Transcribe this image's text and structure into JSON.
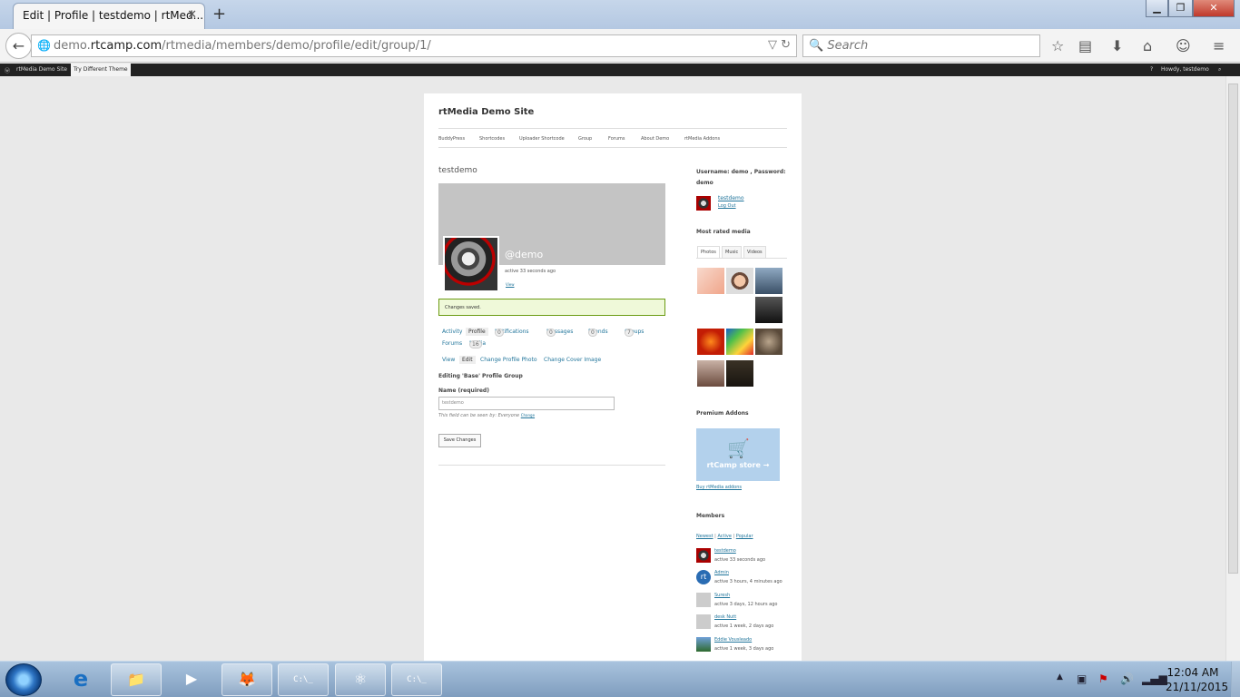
{
  "browser": {
    "tab_title": "Edit | Profile | testdemo | rtMed...",
    "url_prefix": "demo.",
    "url_domain": "rtcamp.com",
    "url_path": "/rtmedia/members/demo/profile/edit/group/1/",
    "search_placeholder": "Search"
  },
  "adminbar": {
    "site_link": "rtMedia Demo Site",
    "try_theme": "Try Different Theme",
    "howdy": "Howdy, testdemo"
  },
  "site": {
    "title": "rtMedia Demo Site",
    "nav": [
      "BuddyPress",
      "Shortcodes",
      "Uploader Shortcode",
      "Group",
      "Forums",
      "About Demo",
      "rtMedia Addons"
    ]
  },
  "profile": {
    "name": "testdemo",
    "handle": "@demo",
    "activity": "active 33 seconds ago",
    "view_link": "View",
    "notice": "Changes saved.",
    "tabs": [
      {
        "label": "Activity"
      },
      {
        "label": "Profile"
      },
      {
        "label": "Notifications",
        "count": "0"
      },
      {
        "label": "Messages",
        "count": "0"
      },
      {
        "label": "Friends",
        "count": "0"
      },
      {
        "label": "Groups",
        "count": "7"
      },
      {
        "label": "Forums"
      },
      {
        "label": "Media",
        "count": "16"
      }
    ],
    "subtabs": [
      "View",
      "Edit",
      "Change Profile Photo",
      "Change Cover Image"
    ],
    "group_heading": "Editing 'Base' Profile Group",
    "field_label": "Name (required)",
    "field_value": "testdemo",
    "visibility_text": "This field can be seen by: Everyone",
    "visibility_link": "Change",
    "save_label": "Save Changes"
  },
  "sidebar": {
    "login_info": "Username: demo , Password: demo",
    "user_name": "testdemo",
    "logout": "Log Out",
    "most_rated_title": "Most rated media",
    "media_tabs": [
      "Photos",
      "Music",
      "Videos"
    ],
    "premium_title": "Premium Addons",
    "store_label": "rtCamp store",
    "buy_link": "Buy rtMedia addons",
    "members_title": "Members",
    "member_filters": [
      "Newest",
      "Active",
      "Popular"
    ],
    "members": [
      {
        "name": "testdemo",
        "activity": "active 33 seconds ago"
      },
      {
        "name": "Admin",
        "activity": "active 3 hours, 4 minutes ago"
      },
      {
        "name": "Suresh",
        "activity": "active 3 days, 12 hours ago"
      },
      {
        "name": "desk Nutt",
        "activity": "active 1 week, 2 days ago"
      },
      {
        "name": "Eddie Vousleado",
        "activity": "active 1 week, 3 days ago"
      }
    ]
  },
  "taskbar": {
    "time": "12:04 AM",
    "date": "21/11/2015"
  }
}
